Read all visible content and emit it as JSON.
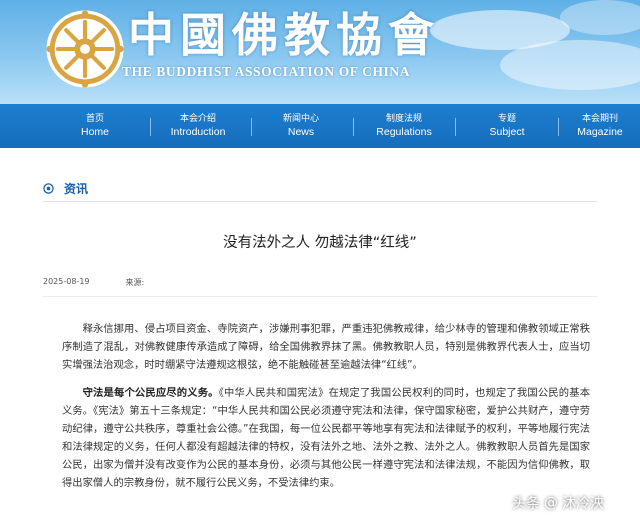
{
  "header": {
    "brand_cn": "中國佛教協會",
    "brand_en": "THE BUDDHIST ASSOCIATION OF CHINA",
    "logo_icon": "dharma-wheel-icon"
  },
  "nav": {
    "items": [
      {
        "cn": "首页",
        "en": "Home"
      },
      {
        "cn": "本会介绍",
        "en": "Introduction"
      },
      {
        "cn": "新闻中心",
        "en": "News"
      },
      {
        "cn": "制度法规",
        "en": "Regulations"
      },
      {
        "cn": "专题",
        "en": "Subject"
      },
      {
        "cn": "本会期刊",
        "en": "Magazine"
      }
    ]
  },
  "section": {
    "title": "资讯",
    "icon": "target-ring-icon"
  },
  "article": {
    "title": "没有法外之人 勿越法律“红线”",
    "date": "2025-08-19",
    "source_label": "来源:",
    "para1": "释永信挪用、侵占项目资金、寺院资产，涉嫌刑事犯罪，严重违犯佛教戒律，给少林寺的管理和佛教领域正常秩序制造了混乱，对佛教健康传承造成了障碍，给全国佛教界抹了黑。佛教教职人员，特别是佛教界代表人士，应当切实增强法治观念，时时绷紧守法遵规这根弦，绝不能触碰甚至逾越法律“红线”。",
    "para2_lead": "守法是每个公民应尽的义务。",
    "para2": "《中华人民共和国宪法》在规定了我国公民权利的同时，也规定了我国公民的基本义务。《宪法》第五十三条规定：“中华人民共和国公民必须遵守宪法和法律，保守国家秘密，爱护公共财产，遵守劳动纪律，遵守公共秩序，尊重社会公德。”在我国，每一位公民都平等地享有宪法和法律赋予的权利，平等地履行宪法和法律规定的义务，任何人都没有超越法律的特权，没有法外之地、法外之教、法外之人。佛教教职人员首先是国家公民，出家为僧并没有改变作为公民的基本身份，必须与其他公民一样遵守宪法和法律法规，不能因为信仰佛教，取得出家僧人的宗教身份，就不履行公民义务，不受法律约束。"
  },
  "watermark": {
    "left": "头条",
    "right": "沐冷泱"
  }
}
